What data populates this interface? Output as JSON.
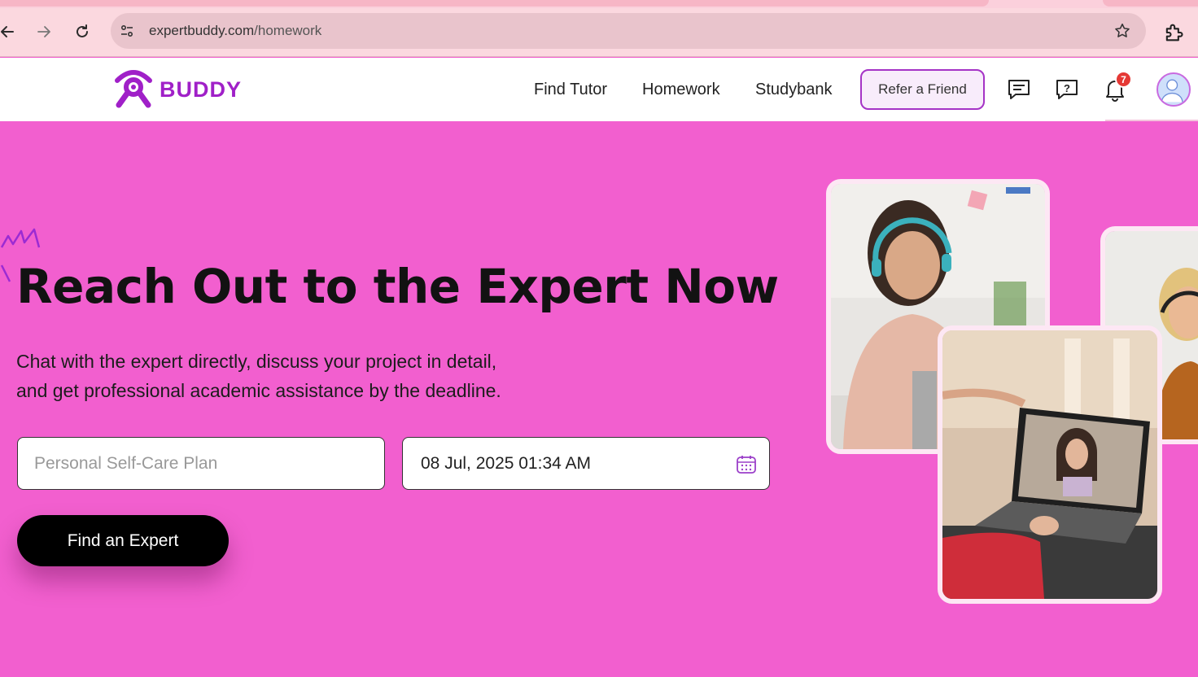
{
  "browser": {
    "url_host": "expertbuddy.com",
    "url_path": "/homework",
    "icons": [
      "back-arrow-icon",
      "forward-arrow-icon",
      "reload-icon",
      "site-settings-icon",
      "bookmark-star-icon",
      "extensions-icon"
    ]
  },
  "header": {
    "logo_text": "BUDDY",
    "nav": [
      "Find Tutor",
      "Homework",
      "Studybank"
    ],
    "refer_label": "Refer a Friend",
    "notification_count": "7",
    "icons": [
      "messages-icon",
      "help-icon",
      "bell-icon",
      "profile-avatar"
    ]
  },
  "hero": {
    "title": "Reach Out to the Expert Now",
    "subtitle_line1": "Chat with the expert directly, discuss your project in detail,",
    "subtitle_line2": "and get professional academic assistance by the deadline.",
    "topic_placeholder": "Personal Self-Care Plan",
    "deadline_value": "08 Jul, 2025 01:34 AM",
    "cta_label": "Find an Expert"
  },
  "colors": {
    "hero_bg": "#f25fcf",
    "brand": "#a020c8",
    "cta_bg": "#000000",
    "badge": "#e53935"
  }
}
